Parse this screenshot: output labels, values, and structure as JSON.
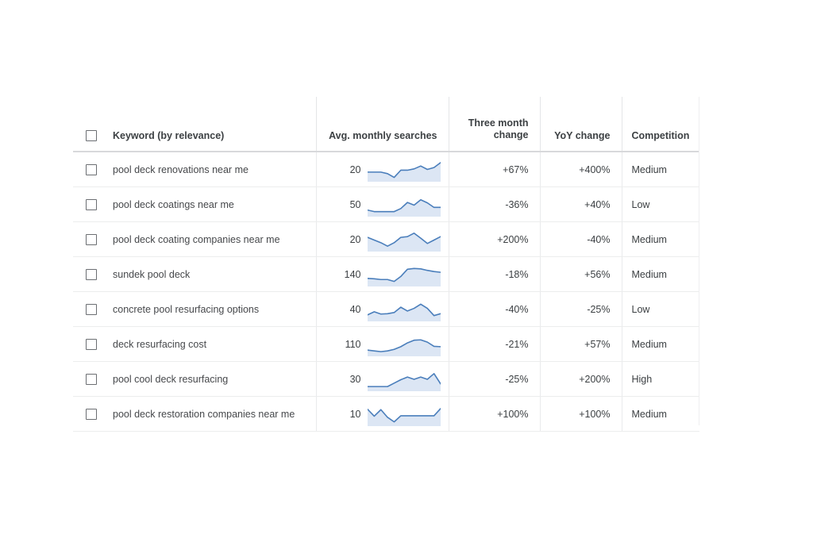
{
  "table": {
    "columns": [
      {
        "key": "select",
        "label": "",
        "icon": "checkbox-icon"
      },
      {
        "key": "keyword",
        "label": "Keyword (by relevance)"
      },
      {
        "key": "avg",
        "label": "Avg. monthly searches"
      },
      {
        "key": "three",
        "label": "Three month change"
      },
      {
        "key": "yoy",
        "label": "YoY change"
      },
      {
        "key": "comp",
        "label": "Competition"
      }
    ],
    "header": {
      "keyword": "Keyword (by relevance)",
      "avg": "Avg. monthly searches",
      "three_line1": "Three month",
      "three_line2": "change",
      "yoy": "YoY change",
      "competition": "Competition"
    },
    "rows": [
      {
        "keyword": "pool deck renovations near me",
        "avg_monthly_searches": "20",
        "three_month_change": "+67%",
        "yoy_change": "+400%",
        "competition": "Medium"
      },
      {
        "keyword": "pool deck coatings near me",
        "avg_monthly_searches": "50",
        "three_month_change": "-36%",
        "yoy_change": "+40%",
        "competition": "Low"
      },
      {
        "keyword": "pool deck coating companies near me",
        "avg_monthly_searches": "20",
        "three_month_change": "+200%",
        "yoy_change": "-40%",
        "competition": "Medium"
      },
      {
        "keyword": "sundek pool deck",
        "avg_monthly_searches": "140",
        "three_month_change": "-18%",
        "yoy_change": "+56%",
        "competition": "Medium"
      },
      {
        "keyword": "concrete pool resurfacing options",
        "avg_monthly_searches": "40",
        "three_month_change": "-40%",
        "yoy_change": "-25%",
        "competition": "Low"
      },
      {
        "keyword": "deck resurfacing cost",
        "avg_monthly_searches": "110",
        "three_month_change": "-21%",
        "yoy_change": "+57%",
        "competition": "Medium"
      },
      {
        "keyword": "pool cool deck resurfacing",
        "avg_monthly_searches": "30",
        "three_month_change": "-25%",
        "yoy_change": "+200%",
        "competition": "High"
      },
      {
        "keyword": "pool deck restoration companies near me",
        "avg_monthly_searches": "10",
        "three_month_change": "+100%",
        "yoy_change": "+100%",
        "competition": "Medium"
      }
    ]
  },
  "colors": {
    "line": "#4a7ebb",
    "fill": "#dce6f4",
    "text": "#3c4043",
    "border": "#eceded",
    "header_rule": "#d8d9db"
  },
  "chart_data": {
    "type": "line",
    "title": "Avg. monthly searches — 12 month sparkline trend per keyword",
    "xlabel": "",
    "ylabel": "",
    "x": [
      1,
      2,
      3,
      4,
      5,
      6,
      7,
      8,
      9,
      10,
      11,
      12
    ],
    "ylim": [
      0,
      100
    ],
    "grid": false,
    "legend": "none",
    "series": [
      {
        "name": "pool deck renovations near me",
        "values": [
          38,
          38,
          38,
          30,
          10,
          48,
          48,
          55,
          70,
          52,
          62,
          88
        ]
      },
      {
        "name": "pool deck coatings near me",
        "values": [
          22,
          14,
          14,
          14,
          14,
          30,
          62,
          48,
          76,
          60,
          36,
          36
        ]
      },
      {
        "name": "pool deck coating companies near me",
        "values": [
          62,
          48,
          34,
          16,
          34,
          62,
          66,
          84,
          58,
          30,
          48,
          66
        ]
      },
      {
        "name": "sundek pool deck",
        "values": [
          30,
          28,
          24,
          24,
          14,
          40,
          78,
          82,
          80,
          72,
          66,
          62
        ]
      },
      {
        "name": "concrete pool resurfacing options",
        "values": [
          22,
          38,
          26,
          28,
          34,
          62,
          42,
          56,
          78,
          56,
          18,
          28
        ]
      },
      {
        "name": "deck resurfacing cost",
        "values": [
          20,
          16,
          12,
          16,
          24,
          38,
          58,
          72,
          74,
          62,
          40,
          38
        ]
      },
      {
        "name": "pool cool deck resurfacing",
        "values": [
          12,
          12,
          12,
          12,
          30,
          48,
          62,
          50,
          62,
          50,
          80,
          26
        ]
      },
      {
        "name": "pool deck restoration companies near me",
        "values": [
          76,
          40,
          74,
          34,
          10,
          42,
          42,
          42,
          42,
          42,
          42,
          80
        ]
      }
    ]
  }
}
